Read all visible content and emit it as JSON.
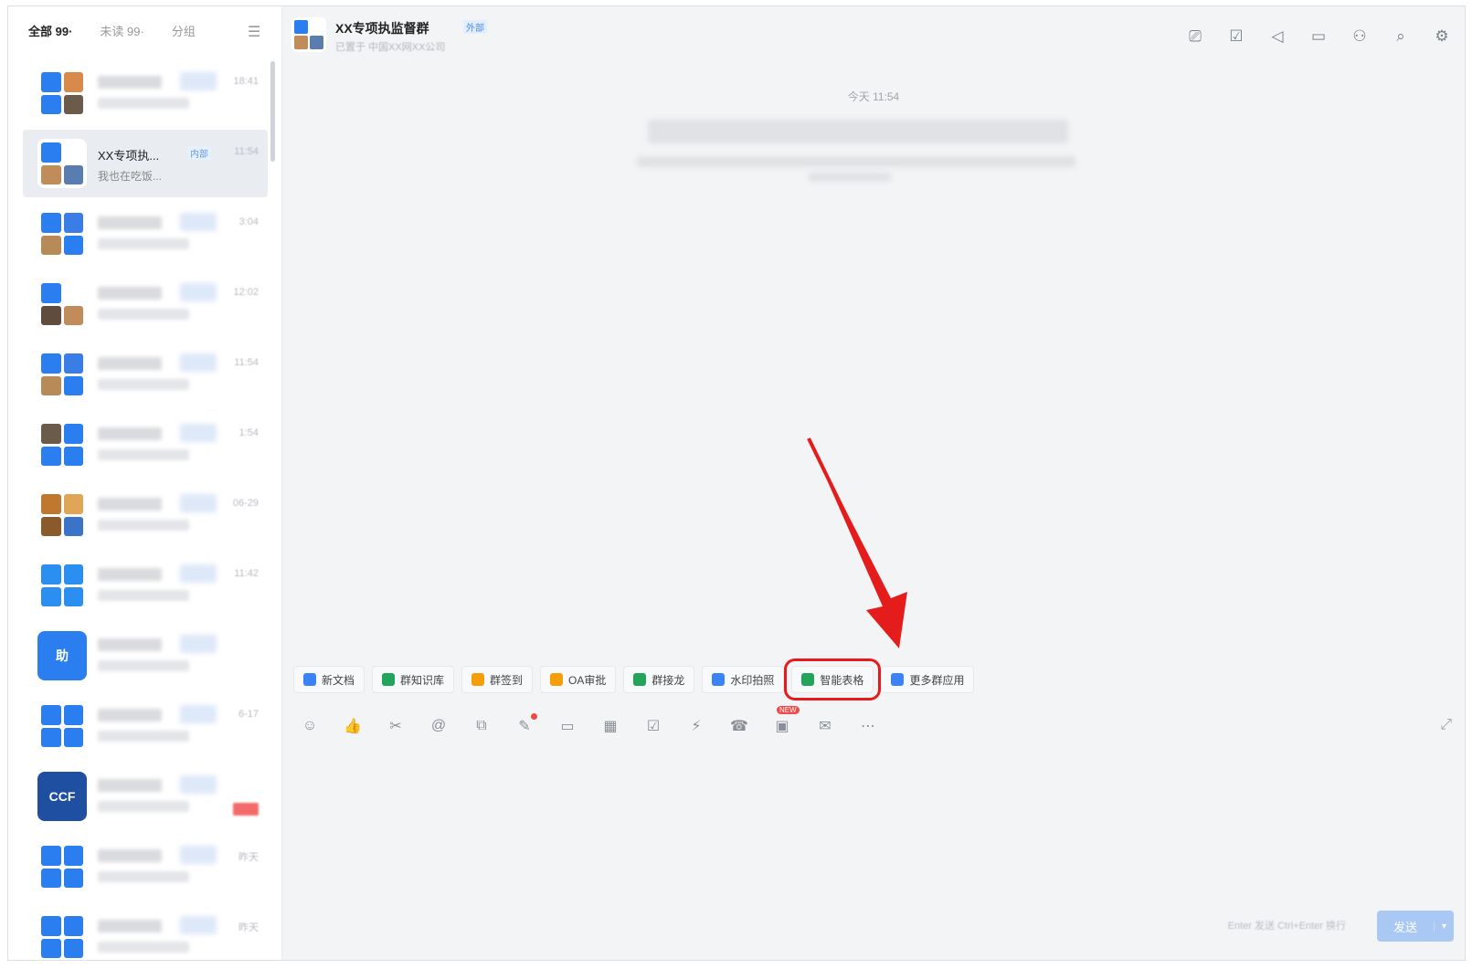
{
  "sidebar": {
    "tabs": [
      {
        "label": "全部 99·"
      },
      {
        "label": "未读 99·"
      },
      {
        "label": "分组"
      }
    ],
    "menu_icon": "menu-icon",
    "conversations": [
      {
        "time": "18:41",
        "colors": [
          "#2a7ef0",
          "#d88a4a",
          "#2a7ef0",
          "#6b5b4a"
        ]
      },
      {
        "name": "XX专项执...",
        "tag": "内部",
        "time": "11:54",
        "preview": "我也在吃饭...",
        "colors": [
          "#2a7ef0",
          "#ffffff",
          "#c08c5a",
          "#5a7db0"
        ]
      },
      {
        "time": "3:04",
        "colors": [
          "#2a7ef0",
          "#3a7de6",
          "#b88a58",
          "#2a7ef0"
        ]
      },
      {
        "time": "12:02",
        "colors": [
          "#2a7ef0",
          "#ffffff",
          "#5f4c3c",
          "#c08c5a"
        ]
      },
      {
        "time": "11:54",
        "colors": [
          "#2a7ef0",
          "#3a7de6",
          "#b88a58",
          "#2a7ef0"
        ]
      },
      {
        "time": "1:54",
        "colors": [
          "#6b5b4a",
          "#2a7ef0",
          "#2a7ef0",
          "#2a7ef0"
        ]
      },
      {
        "time": "06-29",
        "colors": [
          "#c0782e",
          "#e0a658",
          "#8b5a2b",
          "#3a73c8"
        ]
      },
      {
        "time": "11:42",
        "colors": [
          "#2a8ff0",
          "#2a8ff0",
          "#2a8ff0",
          "#2a8ff0"
        ]
      },
      {
        "time": "",
        "solid": "#2a7ef0",
        "glyph": "助"
      },
      {
        "time": "6-17",
        "colors": [
          "#2a7ef0",
          "#2a7ef0",
          "#2a7ef0",
          "#2a7ef0"
        ]
      },
      {
        "time": "",
        "solid": "#1f4fa0",
        "glyph": "CCF"
      },
      {
        "time": "昨天",
        "colors": [
          "#2a7ef0",
          "#2a7ef0",
          "#2a7ef0",
          "#2a7ef0"
        ]
      },
      {
        "time": "昨天",
        "colors": [
          "#2a7ef0",
          "#2a7ef0",
          "#2a7ef0",
          "#2a7ef0"
        ]
      }
    ]
  },
  "chat": {
    "title": "XX专项执监督群",
    "external_tag": "外部",
    "subtitle": "已置于 中国XX网XX公司",
    "header_icons": [
      "video-meeting-icon",
      "task-icon",
      "announcement-icon",
      "folder-icon",
      "members-icon",
      "search-history-icon",
      "settings-icon"
    ],
    "timestamp": "今天 11:54",
    "apps": [
      {
        "label": "新文档",
        "icon": "doc-icon",
        "color": "#3b82f6"
      },
      {
        "label": "群知识库",
        "icon": "knowledge-icon",
        "color": "#22a55a"
      },
      {
        "label": "群签到",
        "icon": "checkin-icon",
        "color": "#f59e0b"
      },
      {
        "label": "OA审批",
        "icon": "approval-icon",
        "color": "#f59e0b"
      },
      {
        "label": "群接龙",
        "icon": "solitaire-icon",
        "color": "#22a55a"
      },
      {
        "label": "水印拍照",
        "icon": "camera-icon",
        "color": "#3b82f6"
      },
      {
        "label": "智能表格",
        "icon": "smart-table-icon",
        "color": "#22a55a",
        "highlight": true
      },
      {
        "label": "更多群应用",
        "icon": "more-apps-icon",
        "color": "#3b82f6"
      }
    ],
    "tools": [
      {
        "name": "emoji-icon",
        "glyph": "☺"
      },
      {
        "name": "like-icon",
        "glyph": "👍"
      },
      {
        "name": "screenshot-icon",
        "glyph": "✂"
      },
      {
        "name": "mention-icon",
        "glyph": "@"
      },
      {
        "name": "quick-reply-icon",
        "glyph": "⧉"
      },
      {
        "name": "doc-share-icon",
        "glyph": "✎",
        "dot": true
      },
      {
        "name": "file-icon",
        "glyph": "▭"
      },
      {
        "name": "calendar-icon",
        "glyph": "▦"
      },
      {
        "name": "todo-icon",
        "glyph": "☑"
      },
      {
        "name": "flash-icon",
        "glyph": "⚡"
      },
      {
        "name": "call-icon",
        "glyph": "☎"
      },
      {
        "name": "live-icon",
        "glyph": "▣",
        "new": "NEW"
      },
      {
        "name": "mail-icon",
        "glyph": "✉"
      },
      {
        "name": "more-icon",
        "glyph": "⋯"
      }
    ],
    "expand_icon": "expand-icon",
    "hint": "Enter 发送  Ctrl+Enter 换行",
    "send_label": "发送"
  }
}
